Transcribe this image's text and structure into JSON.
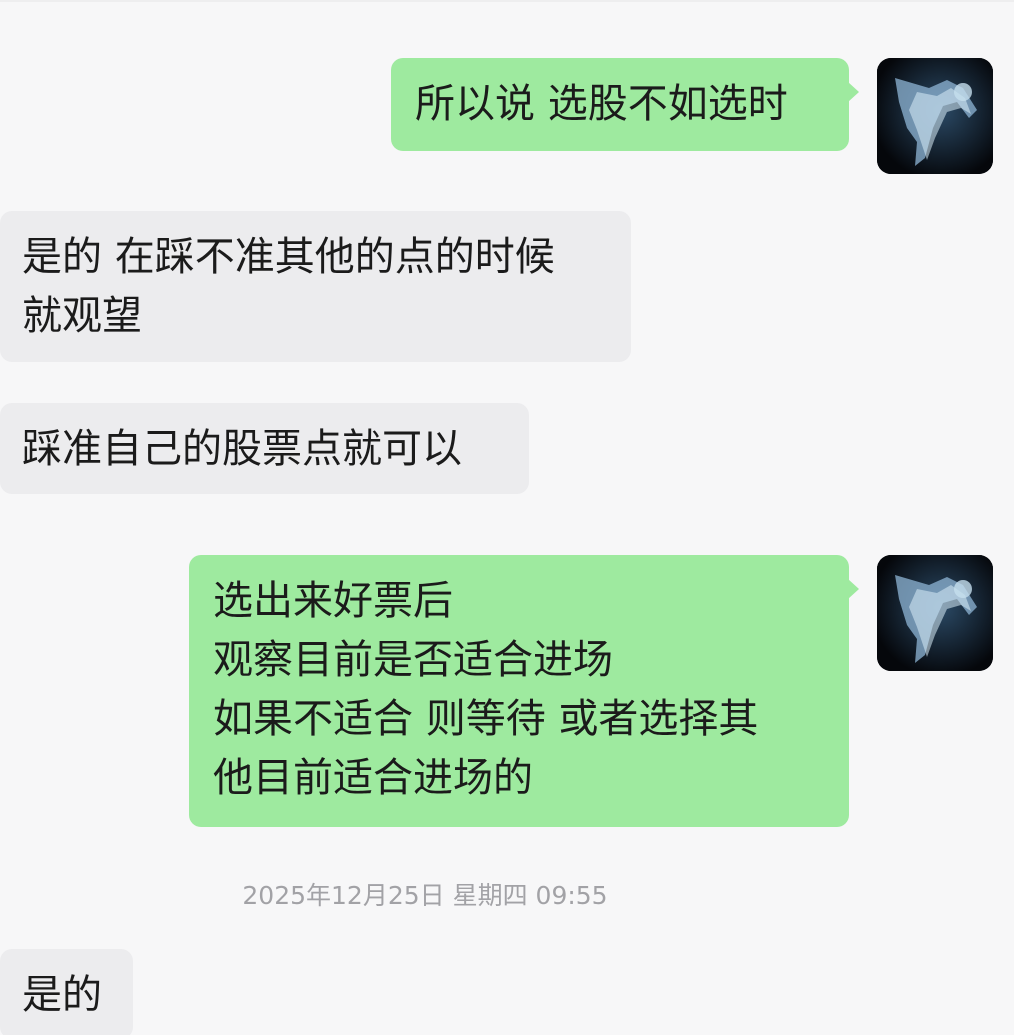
{
  "messages": [
    {
      "side": "out",
      "text": "所以说 选股不如选时",
      "avatar": "figure-avatar-icon"
    },
    {
      "side": "in",
      "text": "是的 在踩不准其他的点的时候\n就观望"
    },
    {
      "side": "in",
      "text": "踩准自己的股票点就可以"
    },
    {
      "side": "out",
      "text": "选出来好票后\n观察目前是否适合进场\n如果不适合 则等待  或者选择其\n他目前适合进场的",
      "avatar": "figure-avatar-icon"
    },
    {
      "side": "in",
      "text": "是的"
    }
  ],
  "timestamp": "2025年12月25日 星期四 09:55",
  "colors": {
    "background": "#f7f7f8",
    "outgoing_bubble": "#9eea9f",
    "incoming_bubble": "#ececee",
    "timestamp_text": "#a2a2a6"
  }
}
